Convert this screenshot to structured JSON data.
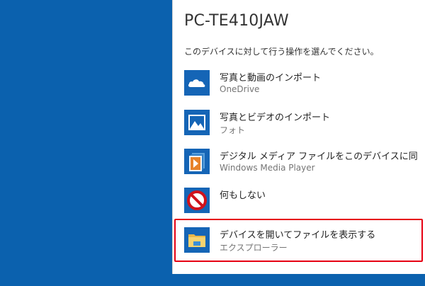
{
  "dialog": {
    "device_name": "PC-TE410JAW",
    "prompt": "このデバイスに対して行う操作を選んでください。"
  },
  "options": [
    {
      "label": "写真と動画のインポート",
      "app": "OneDrive",
      "icon": "onedrive-cloud-icon",
      "color": "#1565b6"
    },
    {
      "label": "写真とビデオのインポート",
      "app": "フォト",
      "icon": "photos-icon",
      "color": "#1565b6"
    },
    {
      "label": "デジタル メディア ファイルをこのデバイスに同期さ...",
      "app": "Windows Media Player",
      "icon": "media-player-icon",
      "color": "#1565b6"
    },
    {
      "label": "何もしない",
      "app": "",
      "icon": "no-entry-icon",
      "color": "#1565b6"
    },
    {
      "label": "デバイスを開いてファイルを表示する",
      "app": "エクスプローラー",
      "icon": "folder-icon",
      "color": "#1565b6"
    }
  ],
  "colors": {
    "desktop": "#0b61ae",
    "tile": "#1565b6",
    "highlight_border": "#e60012"
  }
}
